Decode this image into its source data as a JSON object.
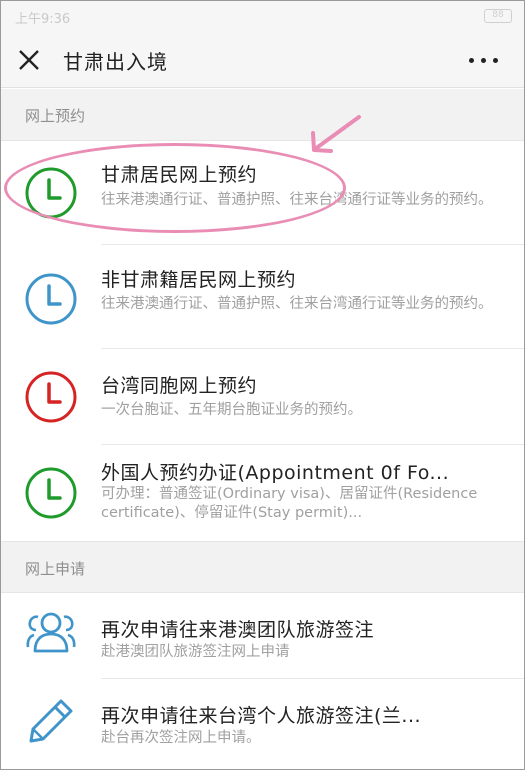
{
  "status": {
    "time": "上午9:36",
    "battery": "88"
  },
  "navbar": {
    "title": "甘肃出入境"
  },
  "sections": {
    "online_booking": "网上预约",
    "online_apply": "网上申请"
  },
  "items": [
    {
      "title": "甘肃居民网上预约",
      "desc": "往来港澳通行证、普通护照、往来台湾通行证等业务的预约。",
      "icon": "clock-icon",
      "color": "#1f9b2b"
    },
    {
      "title": "非甘肃籍居民网上预约",
      "desc": "往来港澳通行证、普通护照、往来台湾通行证等业务的预约。",
      "icon": "clock-icon",
      "color": "#3f95c9"
    },
    {
      "title": "台湾同胞网上预约",
      "desc": "一次台胞证、五年期台胞证业务的预约。",
      "icon": "clock-icon",
      "color": "#d62424"
    },
    {
      "title": "外国人预约办证(Appointment 0f Fo...",
      "desc": "可办理：普通签证(Ordinary visa)、居留证件(Residence certificate)、停留证件(Stay permit)...",
      "icon": "clock-icon",
      "color": "#1f9b2b"
    },
    {
      "title": "再次申请往来港澳团队旅游签注",
      "desc": "赴港澳团队旅游签注网上申请",
      "icon": "group-icon",
      "color": "#3f95c9"
    },
    {
      "title": "再次申请往来台湾个人旅游签注(兰...",
      "desc": "赴台再次签注网上申请。",
      "icon": "pencil-icon",
      "color": "#3f95c9"
    }
  ],
  "annotation": {
    "highlight_color": "#e98db5"
  }
}
